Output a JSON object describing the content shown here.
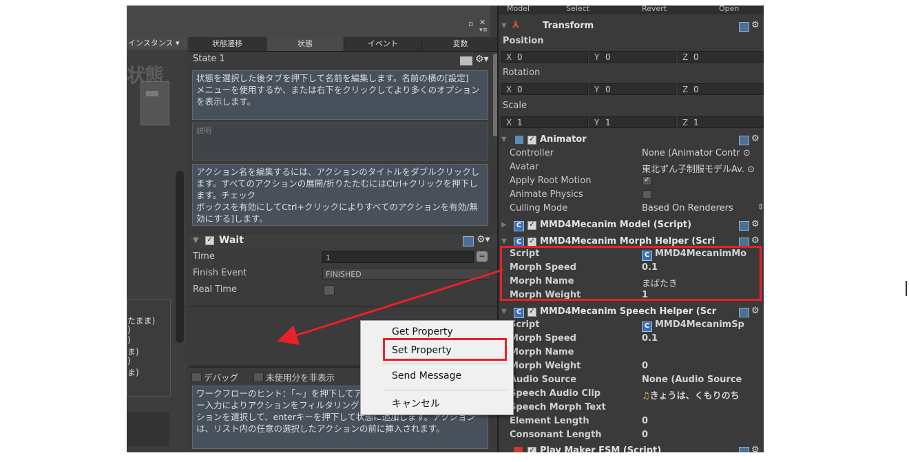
{
  "left_panel": {
    "instance_dropdown": "インスタンス ▾",
    "watermark": "状態",
    "tabs": [
      "状態遷移",
      "状態",
      "イベント",
      "変数"
    ],
    "state_name": "State 1",
    "hint_state": "状態を選択した後タブを押下して名前を編集します。名前の横の[設定]\nメニューを使用するか、または右下をクリックしてより多くのオプションを表示します。",
    "description_placeholder": "説明",
    "hint_actions": "アクション名を編集するには、アクションのタイトルをダブルクリックします。すべてのアクションの展開/折りたたむにはCtrl+クリックを押下します。チェック\nボックスを有効にしてCtrl+クリックによりすべてのアクションを有効/無効にする]します。",
    "state_list": [
      "たまま)",
      ")",
      ")",
      "ま)",
      ")",
      "ま)"
    ],
    "action": {
      "title": "Wait",
      "time_label": "Time",
      "time_value": "1",
      "finish_event_label": "Finish Event",
      "finish_event_value": "FINISHED",
      "real_time_label": "Real Time"
    },
    "debug_label": "デバッグ",
    "hide_unused_label": "未使用分を非表示",
    "workflow_hint": "ワークフローのヒント：「~」を押下してアクションブラウザーを開き、キー入力によりアクションをフィルタリングし、カーソルの上下キーでアクションを選択して、enterキーを押下して状態に追加します。アクションは、リスト内の任意の選択したアクションの前に挿入されます。"
  },
  "inspector": {
    "topbar": [
      "Model",
      "Select",
      "Revert",
      "Open"
    ],
    "transform": {
      "title": "Transform",
      "position_label": "Position",
      "position": {
        "x": "0",
        "y": "0",
        "z": "0"
      },
      "rotation_label": "Rotation",
      "rotation": {
        "x": "0",
        "y": "0",
        "z": "0"
      },
      "scale_label": "Scale",
      "scale": {
        "x": "1",
        "y": "1",
        "z": "1"
      }
    },
    "animator": {
      "title": "Animator",
      "controller_label": "Controller",
      "controller_value": "None (Animator Contr ⊙",
      "avatar_label": "Avatar",
      "avatar_value": "東北ずん子制服モデルAv. ⊙",
      "apply_root_motion_label": "Apply Root Motion",
      "animate_physics_label": "Animate Physics",
      "culling_mode_label": "Culling Mode",
      "culling_mode_value": "Based On Renderers"
    },
    "model_script": {
      "title": "MMD4Mecanim Model (Script)"
    },
    "morph_helper": {
      "title": "MMD4Mecanim Morph Helper (Scri",
      "script_label": "Script",
      "script_value": "MMD4MecanimMo",
      "morph_speed_label": "Morph Speed",
      "morph_speed_value": "0.1",
      "morph_name_label": "Morph Name",
      "morph_name_value": "まばたき",
      "morph_weight_label": "Morph Weight",
      "morph_weight_value": "1"
    },
    "speech_helper": {
      "title": "MMD4Mecanim Speech Helper (Scr",
      "script_label": "Script",
      "script_value": "MMD4MecanimSp",
      "morph_speed_label": "Morph Speed",
      "morph_speed_value": "0.1",
      "morph_name_label": "Morph Name",
      "morph_weight_label": "Morph Weight",
      "morph_weight_value": "0",
      "audio_source_label": "Audio Source",
      "audio_source_value": "None (Audio Source",
      "speech_audio_clip_label": "Speech Audio Clip",
      "speech_audio_clip_value": "きょうは、くもりのち",
      "speech_morph_text_label": "Speech Morph Text",
      "element_length_label": "Element Length",
      "element_length_value": "0",
      "consonant_length_label": "Consonant Length",
      "consonant_length_value": "0"
    },
    "fsm": {
      "title": "Play Maker FSM (Script)"
    }
  },
  "context_menu": {
    "items": [
      "Get Property",
      "Set Property",
      "Send Message",
      "キャンセル"
    ],
    "highlighted": "Set Property"
  },
  "colors": {
    "annotation_red": "#e8212a",
    "panel_bg": "#3a3a3a",
    "hint_box": "#48515b"
  }
}
